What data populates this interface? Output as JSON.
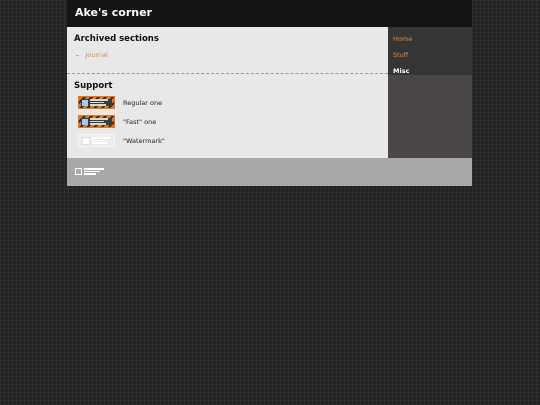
{
  "site": {
    "title": "Ake's corner"
  },
  "archived": {
    "title": "Archived sections",
    "items": [
      {
        "label": "Journal"
      }
    ]
  },
  "support": {
    "title": "Support",
    "badges": [
      {
        "label": "Regular one",
        "icon": "badge-regular-icon"
      },
      {
        "label": "\"Fast\" one",
        "icon": "badge-fast-icon"
      },
      {
        "label": "\"Watermark\"",
        "icon": "badge-watermark-icon"
      }
    ]
  },
  "nav": {
    "items": [
      {
        "label": "Home",
        "active": false
      },
      {
        "label": "Stuff",
        "active": false
      },
      {
        "label": "Misc",
        "active": true
      }
    ]
  },
  "footer": {
    "icon": "footer-badge-icon"
  },
  "colors": {
    "accent": "#e88c2e",
    "header_bg": "#141414",
    "content_bg": "#e8e8e8",
    "sidebar_bg": "#4a4646",
    "footer_bg": "#a9a9a9"
  }
}
